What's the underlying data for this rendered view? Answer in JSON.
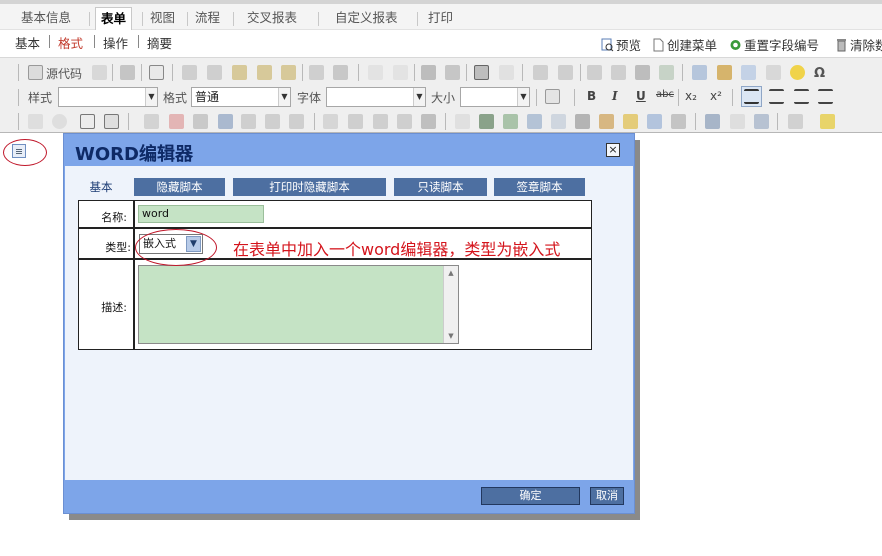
{
  "main_tabs": [
    {
      "label": "基本信息"
    },
    {
      "label": "表单"
    },
    {
      "label": "视图"
    },
    {
      "label": "流程"
    },
    {
      "label": "交叉报表"
    },
    {
      "label": "自定义报表"
    },
    {
      "label": "打印"
    }
  ],
  "active_main_tab": "表单",
  "sub_tabs": [
    {
      "label": "基本"
    },
    {
      "label": "格式"
    },
    {
      "label": "操作"
    },
    {
      "label": "摘要"
    }
  ],
  "active_sub_tab": "格式",
  "top_links": [
    {
      "label": "预览",
      "icon": "preview-icon"
    },
    {
      "label": "创建菜单",
      "icon": "document-icon"
    },
    {
      "label": "重置字段编号",
      "icon": "refresh-icon"
    },
    {
      "label": "清除数",
      "icon": "trash-icon"
    }
  ],
  "toolbar": {
    "source_label": "源代码",
    "style_label": "样式",
    "format_label": "格式",
    "format_value": "普通",
    "font_label": "字体",
    "size_label": "大小",
    "bold": "B",
    "italic": "I",
    "underline": "U",
    "strike": "abc",
    "subscript": "x₂",
    "superscript": "x²",
    "special_char": "Ω"
  },
  "dialog": {
    "title": "WORD编辑器",
    "close_glyph": "×",
    "tabs": [
      {
        "label": "基本"
      },
      {
        "label": "隐藏脚本"
      },
      {
        "label": "打印时隐藏脚本"
      },
      {
        "label": "只读脚本"
      },
      {
        "label": "签章脚本"
      }
    ],
    "active_tab": "基本",
    "fields": {
      "name_label": "名称:",
      "name_value": "word",
      "type_label": "类型:",
      "type_value": "嵌入式",
      "desc_label": "描述:",
      "desc_value": ""
    },
    "annotation": "在表单中加入一个word编辑器，类型为嵌入式",
    "ok_label": "确定",
    "cancel_label": "取消"
  },
  "colors": {
    "dialog_frame": "#7da5e9",
    "dialog_body": "#eef3fb",
    "tab_button": "#4d6fa1",
    "field_green": "#c5e3c5",
    "annotation_red": "#d4141c"
  }
}
